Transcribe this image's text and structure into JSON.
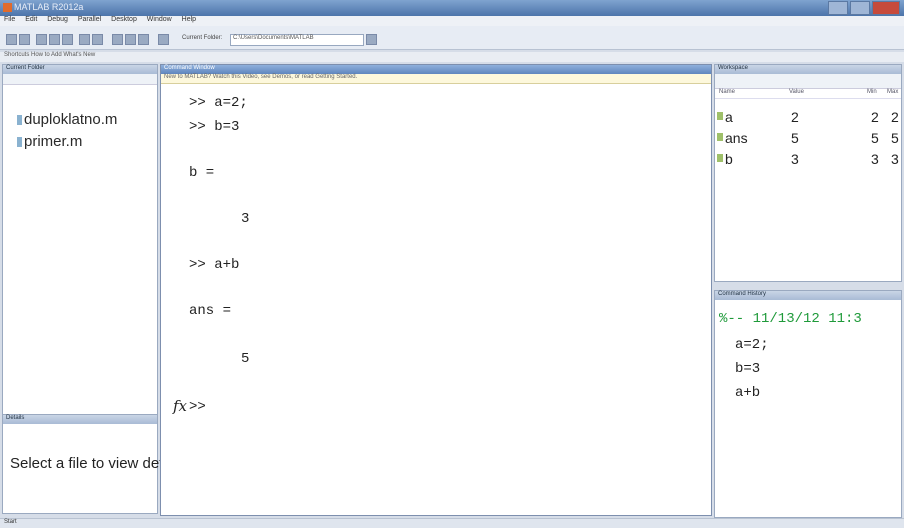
{
  "window": {
    "title": "MATLAB R2012a"
  },
  "menu": [
    "File",
    "Edit",
    "Debug",
    "Parallel",
    "Desktop",
    "Window",
    "Help"
  ],
  "toolbar": {
    "current_folder_label": "Current Folder:",
    "current_folder_value": "C:\\Users\\Documents\\MATLAB"
  },
  "shortcuts": "Shortcuts  How to Add  What's New",
  "current_folder": {
    "header": "Current Folder",
    "files": [
      "duploklatno.m",
      "primer.m"
    ]
  },
  "details": {
    "header": "Details",
    "message": "Select a file to view details"
  },
  "command_window": {
    "header": "Command Window",
    "notice": "New to MATLAB? Watch this Video, see Demos, or read Getting Started.",
    "lines": [
      ">> a=2;",
      ">> b=3",
      "b =",
      "3",
      ">> a+b",
      "ans =",
      "5",
      ">>"
    ],
    "fx": "fx"
  },
  "workspace": {
    "header": "Workspace",
    "columns": [
      "Name",
      "Value",
      "Min",
      "Max"
    ],
    "rows": [
      {
        "name": "a",
        "value": "2",
        "min": "2",
        "max": "2"
      },
      {
        "name": "ans",
        "value": "5",
        "min": "5",
        "max": "5"
      },
      {
        "name": "b",
        "value": "3",
        "min": "3",
        "max": "3"
      }
    ]
  },
  "history": {
    "header": "Command History",
    "session": "%-- 11/13/12 11:3",
    "entries": [
      "a=2;",
      "b=3",
      "a+b"
    ]
  },
  "status": {
    "start_label": "Start"
  },
  "colors": {
    "titlebar": "#4c74aa",
    "history_session": "#1f9a3a",
    "workspace_icon": "#9fc06a"
  }
}
